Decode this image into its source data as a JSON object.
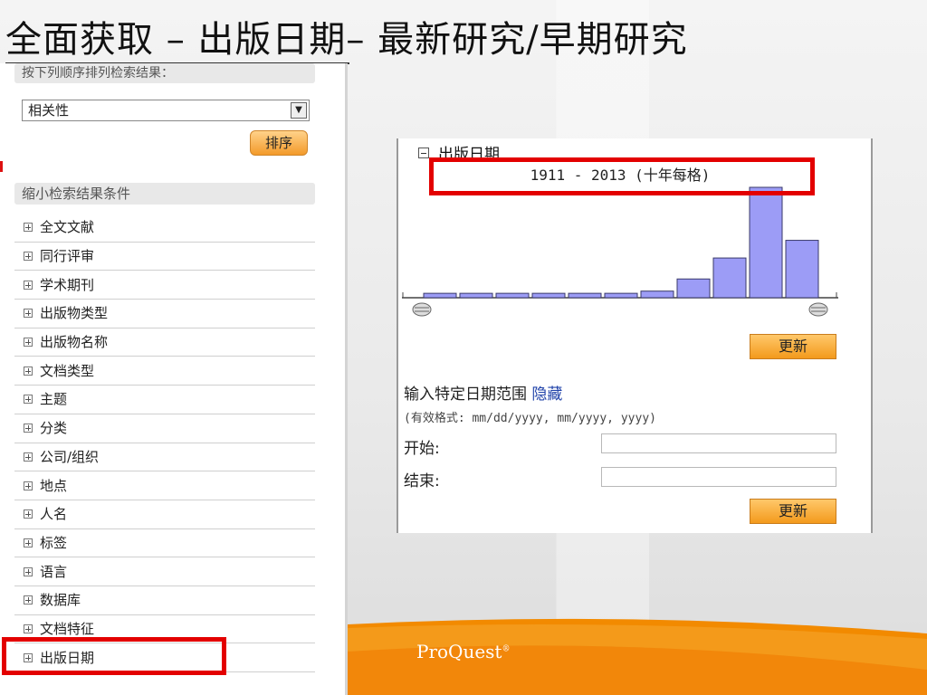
{
  "slide": {
    "title": "全面获取 – 出版日期– 最新研究/早期研究"
  },
  "sort_panel": {
    "heading": "按下列顺序排列检索结果：",
    "select_value": "相关性",
    "sort_button": "排序"
  },
  "narrow_panel": {
    "heading": "缩小检索结果条件",
    "items": [
      "全文文献",
      "同行评审",
      "学术期刊",
      "出版物类型",
      "出版物名称",
      "文档类型",
      "主题",
      "分类",
      "公司/组织",
      "地点",
      "人名",
      "标签",
      "语言",
      "数据库",
      "文档特征",
      "出版日期"
    ]
  },
  "date_panel": {
    "heading": "出版日期",
    "range_label": "1911 - 2013 (十年每格)",
    "update_button": "更新",
    "specific_label": "输入特定日期范围",
    "hide_link": "隐藏",
    "format_hint": "(有效格式: mm/dd/yyyy, mm/yyyy, yyyy)",
    "start_label": "开始:",
    "end_label": "结束:",
    "start_value": "",
    "end_value": "",
    "update_button_2": "更新"
  },
  "histogram": {
    "bar_fractions": [
      0.04,
      0.04,
      0.04,
      0.04,
      0.04,
      0.04,
      0.06,
      0.17,
      0.36,
      1.0,
      0.52
    ],
    "bar_color": "#9c9cf6",
    "bar_border": "#3a3a6a"
  },
  "branding": {
    "logo_text": "ProQuest"
  },
  "colors": {
    "highlight": "#e30000",
    "button_orange": "#f39a1c"
  }
}
